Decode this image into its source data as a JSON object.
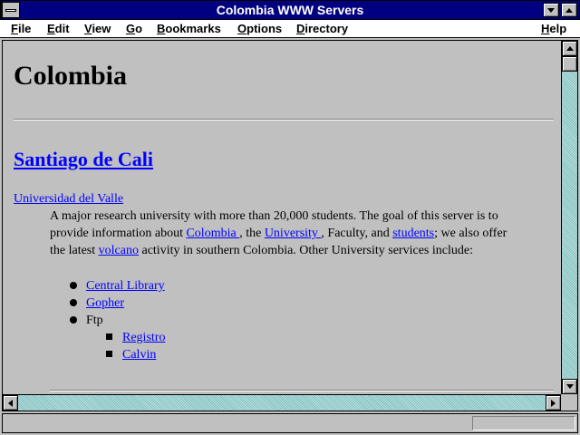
{
  "window": {
    "title": "Colombia WWW Servers"
  },
  "menu": {
    "file": {
      "accel": "F",
      "rest": "ile"
    },
    "edit": {
      "accel": "E",
      "rest": "dit"
    },
    "view": {
      "accel": "V",
      "rest": "iew"
    },
    "go": {
      "accel": "G",
      "rest": "o"
    },
    "bookmarks": {
      "accel": "B",
      "rest": "ookmarks"
    },
    "options": {
      "accel": "O",
      "rest": "ptions"
    },
    "directory": {
      "accel": "D",
      "rest": "irectory"
    },
    "help": {
      "accel": "H",
      "rest": "elp"
    }
  },
  "page": {
    "heading": "Colombia",
    "section_link": "Santiago de Cali",
    "univ_link": "Universidad del Valle",
    "para": {
      "l1": "A major research university with more than 20,000 students. The goal of this server is to",
      "l2_a": "provide information about ",
      "l2_link1": "Colombia ",
      "l2_b": ", the ",
      "l2_link2": "University ",
      "l2_c": ", Faculty, and ",
      "l2_link3": "students",
      "l2_d": "; we also offer",
      "l3_a": "the latest ",
      "l3_link": "volcano",
      "l3_b": " activity in southern Colombia. Other University services include:"
    },
    "list": {
      "item1": "Central Library",
      "item2": "Gopher",
      "item3": "Ftp",
      "sub1": "Registro",
      "sub2": "Calvin"
    }
  },
  "colors": {
    "title_bg": "#000080",
    "link": "#0000ff",
    "window_bg": "#c0c0c0"
  },
  "icons": [
    "system-menu-icon",
    "minimize-icon",
    "maximize-icon",
    "scroll-up-icon",
    "scroll-down-icon",
    "scroll-left-icon",
    "scroll-right-icon"
  ]
}
